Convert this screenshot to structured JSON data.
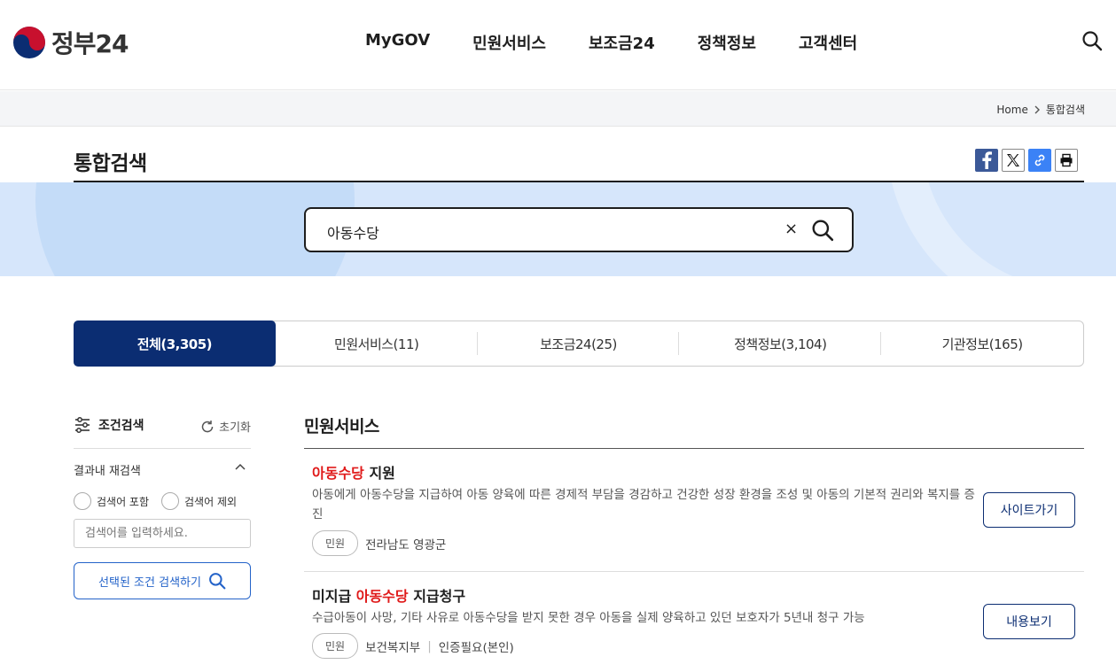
{
  "header": {
    "logo_text": "정부24",
    "nav": [
      "MyGOV",
      "민원서비스",
      "보조금24",
      "정책정보",
      "고객센터"
    ]
  },
  "breadcrumb": {
    "home": "Home",
    "current": "통합검색"
  },
  "page": {
    "title": "통합검색"
  },
  "search": {
    "value": "아동수당",
    "clear": "×"
  },
  "tabs": [
    {
      "label": "전체(3,305)",
      "active": true
    },
    {
      "label": "민원서비스(11)",
      "active": false
    },
    {
      "label": "보조금24(25)",
      "active": false
    },
    {
      "label": "정책정보(3,104)",
      "active": false
    },
    {
      "label": "기관정보(165)",
      "active": false
    }
  ],
  "filter": {
    "title": "조건검색",
    "reset": "초기화",
    "refine_title": "결과내 재검색",
    "include": "검색어 포함",
    "exclude": "검색어 제외",
    "placeholder": "검색어를 입력하세요.",
    "submit": "선택된 조건 검색하기"
  },
  "section": {
    "title": "민원서비스"
  },
  "results": [
    {
      "title_hl": "아동수당",
      "title_rest": " 지원",
      "desc": "아동에게 아동수당을 지급하여 아동 양육에 따른 경제적 부담을 경감하고 건강한 성장 환경을 조성 및 아동의 기본적 권리와 복지를 증진",
      "badge": "민원",
      "org": "전라남도 영광군",
      "button": "사이트가기"
    },
    {
      "title_pre": "미지급 ",
      "title_hl": "아동수당",
      "title_rest": " 지급청구",
      "desc": "수급아동이 사망, 기타 사유로 아동수당을 받지 못한 경우 아동을 실제 양육하고 있던 보호자가 5년내 청구 가능",
      "badge": "민원",
      "org": "보건복지부",
      "sep": "|",
      "auth": "인증필요(본인)",
      "button": "내용보기"
    }
  ],
  "colors": {
    "primary": "#0b2d72",
    "highlight": "#e01b1b",
    "band": "#d6e6fb"
  }
}
